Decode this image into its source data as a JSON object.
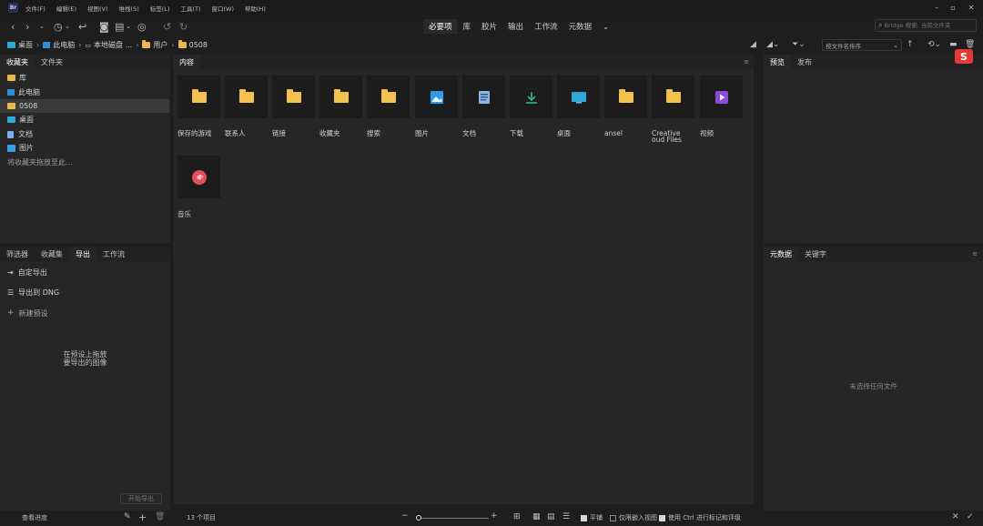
{
  "menu": {
    "items": [
      "文件(F)",
      "编辑(E)",
      "视图(V)",
      "堆栈(S)",
      "标签(L)",
      "工具(T)",
      "窗口(W)",
      "帮助(H)"
    ]
  },
  "app_logo": "Br",
  "workspaces": [
    "必要项",
    "库",
    "胶片",
    "输出",
    "工作流",
    "元数据"
  ],
  "search": {
    "placeholder": "Bridge 搜索: 当前文件夹"
  },
  "breadcrumb": [
    "桌面",
    "此电脑",
    "本地磁盘 ...",
    "用户",
    "0508"
  ],
  "sort_label": "按文件名排序",
  "favorites_panel": {
    "tabs": [
      "收藏夹",
      "文件夹"
    ],
    "items": [
      "库",
      "此电脑",
      "0508",
      "桌面",
      "文档",
      "图片"
    ],
    "hint": "将收藏夹拖放至此..."
  },
  "content_panel": {
    "tab": "内容",
    "items": [
      "保存的游戏",
      "联系人",
      "链接",
      "收藏夹",
      "搜索",
      "图片",
      "文档",
      "下载",
      "桌面",
      "ansel",
      "Creative\noud Files",
      "视频",
      "音乐"
    ]
  },
  "preview_panel": {
    "tabs": [
      "预览",
      "发布"
    ]
  },
  "export_panel": {
    "tabs": [
      "筛选器",
      "收藏集",
      "导出",
      "工作流"
    ],
    "items": [
      "自定导出",
      "导出到 DNG",
      "新建预设"
    ],
    "hint_line1": "在预设上拖放",
    "hint_line2": "要导出的图像",
    "start_button": "开始导出",
    "view_progress": "查看进度"
  },
  "metadata_panel": {
    "tabs": [
      "元数据",
      "关键字"
    ],
    "empty_text": "未选择任何文件"
  },
  "status": {
    "count": "13 个项目",
    "smooth_label": "平铺",
    "embedded_label": "仅限嵌入视图",
    "ctrl_label": "使用 Ctrl 进行标记和评级"
  },
  "colors": {
    "folder": "#f2c14e",
    "accent_blue": "#2fa8d8",
    "bg": "#262626"
  }
}
